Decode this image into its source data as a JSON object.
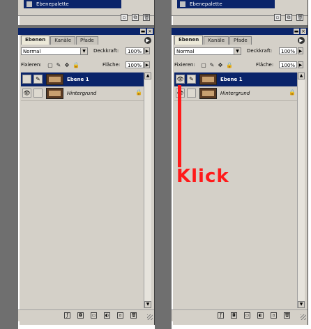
{
  "panels": [
    {
      "top_strip_label": "Ebenepalette",
      "tabs": [
        {
          "label": "Ebenen"
        },
        {
          "label": "Kanäle"
        },
        {
          "label": "Pfade"
        }
      ],
      "blend_mode": "Normal",
      "opacity_label": "Deckkraft:",
      "opacity_value": "100%",
      "lock_label": "Fixieren:",
      "fill_label": "Fläche:",
      "fill_value": "100%",
      "layers": [
        {
          "name": "Ebene 1",
          "selected": true,
          "visible": false
        },
        {
          "name": "Hintergrund",
          "selected": false,
          "visible": true,
          "locked": true
        }
      ]
    },
    {
      "top_strip_label": "Ebenepalette",
      "tabs": [
        {
          "label": "Ebenen"
        },
        {
          "label": "Kanäle"
        },
        {
          "label": "Pfade"
        }
      ],
      "blend_mode": "Normal",
      "opacity_label": "Deckkraft:",
      "opacity_value": "100%",
      "lock_label": "Fixieren:",
      "fill_label": "Fläche:",
      "fill_value": "100%",
      "layers": [
        {
          "name": "Ebene 1",
          "selected": true,
          "visible": true
        },
        {
          "name": "Hintergrund",
          "selected": false,
          "visible": true,
          "locked": true
        }
      ]
    }
  ],
  "annotation": {
    "text": "Klick",
    "color": "#ff1a1a"
  },
  "colors": {
    "panel_bg": "#d4d0c8",
    "title_blue": "#0a246a",
    "selection_blue": "#0a246a",
    "separator_gray": "#6f6f6f"
  },
  "icons": [
    "eye-icon",
    "brush-icon",
    "lock-icon",
    "trash-icon",
    "new-layer-icon",
    "folder-icon",
    "mask-icon",
    "fx-icon",
    "adjustment-icon"
  ]
}
